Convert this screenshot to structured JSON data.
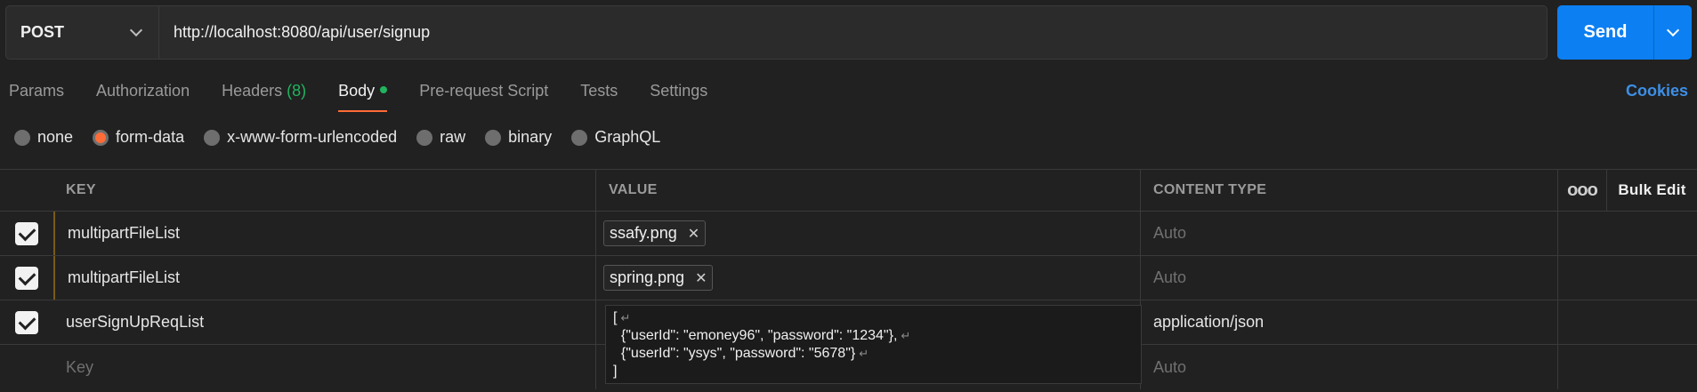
{
  "request": {
    "method": "POST",
    "url": "http://localhost:8080/api/user/signup",
    "send_label": "Send"
  },
  "tabs": [
    {
      "label": "Params"
    },
    {
      "label": "Authorization"
    },
    {
      "label": "Headers",
      "count": "(8)"
    },
    {
      "label": "Body"
    },
    {
      "label": "Pre-request Script"
    },
    {
      "label": "Tests"
    },
    {
      "label": "Settings"
    }
  ],
  "cookies_label": "Cookies",
  "body_types": [
    {
      "label": "none",
      "selected": false
    },
    {
      "label": "form-data",
      "selected": true
    },
    {
      "label": "x-www-form-urlencoded",
      "selected": false
    },
    {
      "label": "raw",
      "selected": false
    },
    {
      "label": "binary",
      "selected": false
    },
    {
      "label": "GraphQL",
      "selected": false
    }
  ],
  "table": {
    "headers": {
      "key": "KEY",
      "value": "VALUE",
      "content_type": "CONTENT TYPE",
      "more": "ooo",
      "bulk_edit": "Bulk Edit"
    },
    "rows": [
      {
        "key": "multipartFileList",
        "file": "ssafy.png",
        "content_type_placeholder": "Auto"
      },
      {
        "key": "multipartFileList",
        "file": "spring.png",
        "content_type_placeholder": "Auto"
      },
      {
        "key": "userSignUpReqList",
        "content_type": "application/json",
        "json_lines": [
          "[",
          "  {\"userId\": \"emoney96\", \"password\": \"1234\"},",
          "  {\"userId\": \"ysys\", \"password\": \"5678\"}",
          "]"
        ]
      }
    ],
    "new_row": {
      "key_placeholder": "Key",
      "content_type_placeholder": "Auto"
    }
  },
  "colors": {
    "accent": "#ff6c37",
    "send": "#0c7ff2",
    "green": "#20b45e"
  }
}
